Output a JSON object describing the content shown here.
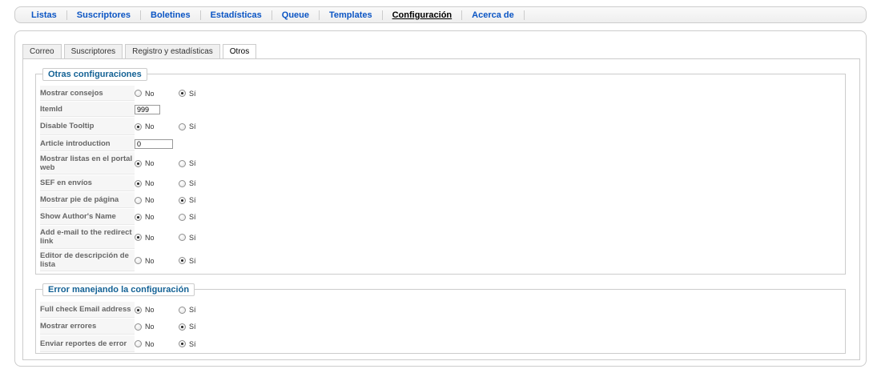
{
  "nav": [
    "Listas",
    "Suscriptores",
    "Boletines",
    "Estadísticas",
    "Queue",
    "Templates",
    "Configuración",
    "Acerca de"
  ],
  "nav_active": "Configuración",
  "tabs": [
    "Correo",
    "Suscriptores",
    "Registro y estadísticas",
    "Otros"
  ],
  "tab_active": "Otros",
  "radio_labels": {
    "no": "No",
    "si": "Sí"
  },
  "section1": {
    "title": "Otras configuraciones",
    "rows": [
      {
        "label": "Mostrar consejos",
        "type": "radio",
        "value": "si"
      },
      {
        "label": "ItemId",
        "type": "text",
        "value": "999"
      },
      {
        "label": "Disable Tooltip",
        "type": "radio",
        "value": "no"
      },
      {
        "label": "Article introduction",
        "type": "text",
        "value": "0"
      },
      {
        "label": "Mostrar listas en el portal web",
        "type": "radio",
        "value": "no"
      },
      {
        "label": "SEF en envíos",
        "type": "radio",
        "value": "no"
      },
      {
        "label": "Mostrar pie de página",
        "type": "radio",
        "value": "si"
      },
      {
        "label": "Show Author's Name",
        "type": "radio",
        "value": "no"
      },
      {
        "label": "Add e-mail to the redirect link",
        "type": "radio",
        "value": "no"
      },
      {
        "label": "Editor de descripción de lista",
        "type": "radio",
        "value": "si"
      }
    ]
  },
  "section2": {
    "title": "Error manejando la configuración",
    "rows": [
      {
        "label": "Full check Email address",
        "type": "radio",
        "value": "no"
      },
      {
        "label": "Mostrar errores",
        "type": "radio",
        "value": "si"
      },
      {
        "label": "Enviar reportes de error",
        "type": "radio",
        "value": "si"
      }
    ]
  }
}
